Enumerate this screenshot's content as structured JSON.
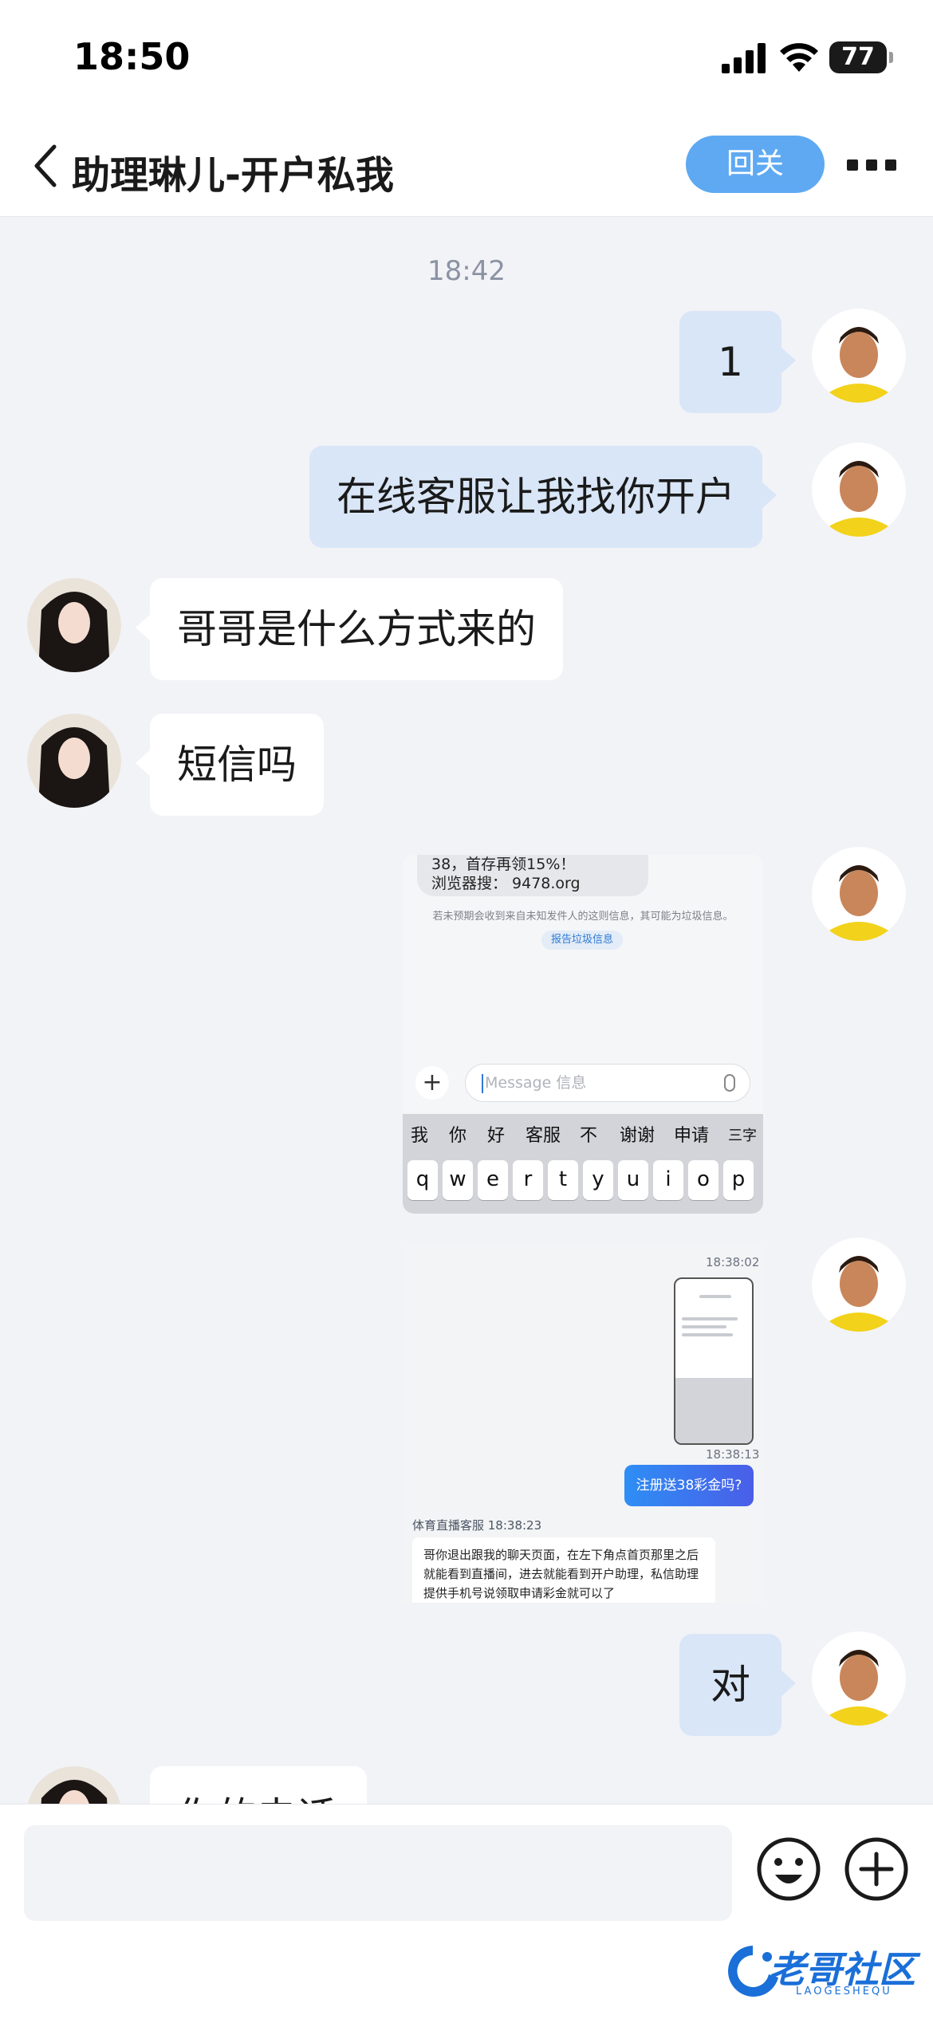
{
  "status_bar": {
    "time": "18:50",
    "battery": "77"
  },
  "header": {
    "title": "助理琳儿-开户私我",
    "follow_label": "回关"
  },
  "chat": {
    "timestamp": "18:42",
    "messages": [
      {
        "side": "right",
        "text": "1"
      },
      {
        "side": "right",
        "text": "在线客服让我找你开户"
      },
      {
        "side": "left",
        "text": "哥哥是什么方式来的"
      },
      {
        "side": "left",
        "text": "短信吗"
      },
      {
        "side": "right",
        "text": "对"
      },
      {
        "side": "left",
        "text": "你的电话"
      }
    ],
    "image1": {
      "sms_line1": "38，首存再领15%！",
      "sms_line2": "浏览器搜： 9478.org",
      "warning": "若未预期会收到来自未知发件人的这则信息，其可能为垃圾信息。",
      "report_label": "报告垃圾信息",
      "input_placeholder": "Message 信息",
      "candidates": [
        "我",
        "你",
        "好",
        "客服",
        "不",
        "谢谢",
        "申请",
        "三字"
      ],
      "keys": [
        "q",
        "w",
        "e",
        "r",
        "t",
        "y",
        "u",
        "i",
        "o",
        "p"
      ]
    },
    "image2": {
      "time1": "18:38:02",
      "time2": "18:38:13",
      "pill_text": "注册送38彩金吗?",
      "sender": "体育直播客服 18:38:23",
      "reply_text": "哥你退出跟我的聊天页面，在左下角点首页那里之后就能看到直播间，进去就能看到开户助理，私信助理提供手机号说领取申请彩金就可以了"
    }
  },
  "watermark": {
    "text": "老哥社区",
    "sub": "LAOGESHEQU"
  },
  "colors": {
    "accent": "#5ea9f2",
    "right_bubble": "#d9e6f7",
    "background": "#f2f3f7"
  },
  "icons": [
    "back-chevron-icon",
    "more-icon",
    "emoji-icon",
    "plus-circle-icon",
    "signal-icon",
    "wifi-icon"
  ]
}
